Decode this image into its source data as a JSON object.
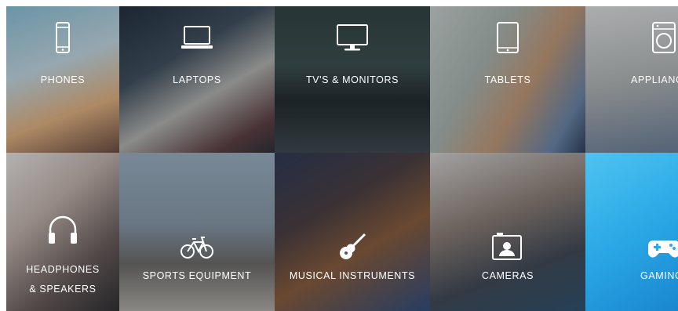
{
  "categories": {
    "phones": {
      "label": "PHONES",
      "icon": "phone-icon"
    },
    "laptops": {
      "label": "LAPTOPS",
      "icon": "laptop-icon"
    },
    "tv": {
      "label": "TV'S & MONITORS",
      "icon": "monitor-icon"
    },
    "tablets": {
      "label": "TABLETS",
      "icon": "tablet-icon"
    },
    "appliances": {
      "label": "APPLIANC",
      "icon": "washing-machine-icon"
    },
    "headphones": {
      "label_line1": "HEADPHONES",
      "label_line2": "& SPEAKERS",
      "icon": "headphones-icon"
    },
    "sports": {
      "label": "SPORTS EQUIPMENT",
      "icon": "bicycle-icon"
    },
    "music": {
      "label": "MUSICAL INSTRUMENTS",
      "icon": "guitar-icon"
    },
    "cameras": {
      "label": "CAMERAS",
      "icon": "camera-icon"
    },
    "gaming": {
      "label": "GAMING",
      "icon": "gamepad-icon"
    }
  },
  "colors": {
    "label_text": "#ffffff",
    "gaming_tile": "#2aa9e6"
  }
}
